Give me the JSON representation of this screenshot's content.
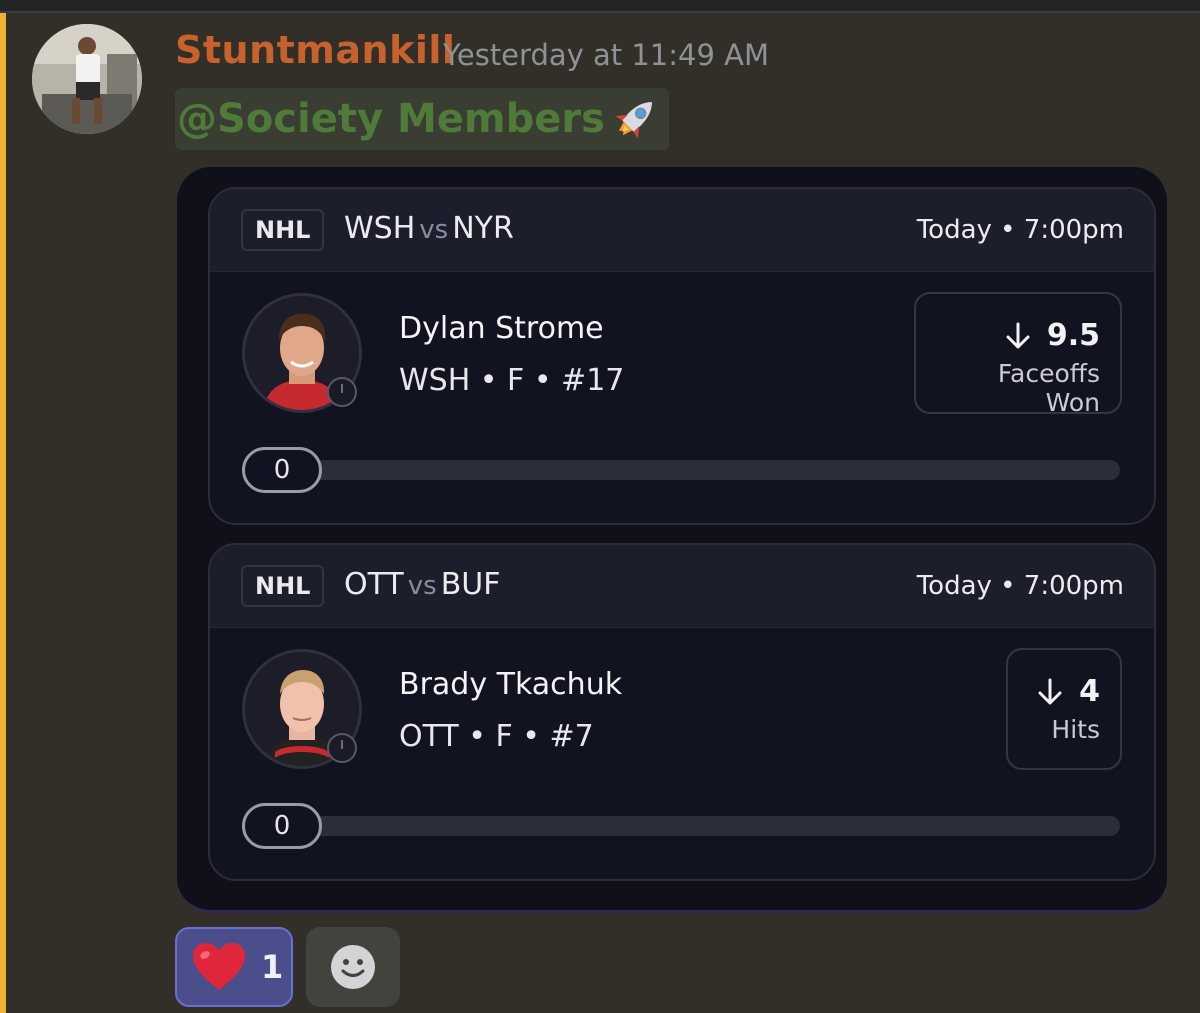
{
  "message": {
    "username": "Stuntmankill",
    "timestamp": "Yesterday at 11:49 AM",
    "mention": "@Society Members",
    "mention_emoji": "rocket-icon"
  },
  "cards": [
    {
      "league": "NHL",
      "home": "WSH",
      "vs": "vs",
      "away": "NYR",
      "time": "Today • 7:00pm",
      "player_name": "Dylan Strome",
      "player_meta": "WSH • F • #17",
      "direction": "under",
      "line": "9.5",
      "stat": "Faceoffs Won",
      "progress_label": "0",
      "progress_fraction": 0
    },
    {
      "league": "NHL",
      "home": "OTT",
      "vs": "vs",
      "away": "BUF",
      "time": "Today • 7:00pm",
      "player_name": "Brady Tkachuk",
      "player_meta": "OTT • F • #7",
      "direction": "under",
      "line": "4",
      "stat": "Hits",
      "progress_label": "0",
      "progress_fraction": 0
    }
  ],
  "reactions": [
    {
      "emoji": "heart-icon",
      "count": "1"
    }
  ],
  "add_reaction_icon": "smiley-icon",
  "colors": {
    "username": "#c8622c",
    "mention": "#4f7a3a",
    "accent_bar": "#f0b232",
    "reaction_bg": "#4a4f8c"
  }
}
